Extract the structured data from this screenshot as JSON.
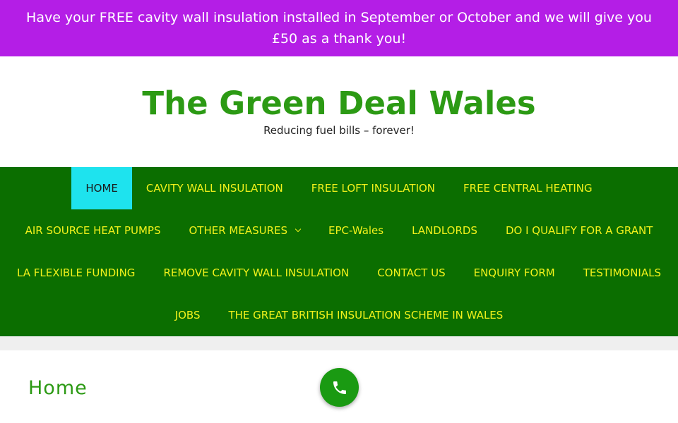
{
  "promo": {
    "text": "Have your FREE cavity wall insulation installed in September or October and we will give you £50 as a thank you!",
    "background": "#b41ee6"
  },
  "site": {
    "title": "The Green Deal Wales",
    "tagline": "Reducing fuel bills – forever!",
    "title_color": "#2c9a14"
  },
  "nav": {
    "background": "#0b6e00",
    "text_color": "#f2f21b",
    "active_background": "#1ee3ee",
    "items": [
      {
        "label": "HOME",
        "active": true
      },
      {
        "label": "CAVITY WALL INSULATION"
      },
      {
        "label": "FREE LOFT INSULATION"
      },
      {
        "label": "FREE CENTRAL HEATING"
      },
      {
        "label": "AIR SOURCE HEAT PUMPS"
      },
      {
        "label": "OTHER MEASURES",
        "has_dropdown": true
      },
      {
        "label": "EPC-Wales"
      },
      {
        "label": "LANDLORDS"
      },
      {
        "label": "DO I QUALIFY FOR A GRANT"
      },
      {
        "label": "LA FLEXIBLE FUNDING"
      },
      {
        "label": "REMOVE CAVITY WALL INSULATION"
      },
      {
        "label": "CONTACT US"
      },
      {
        "label": "ENQUIRY FORM"
      },
      {
        "label": "TESTIMONIALS"
      },
      {
        "label": "JOBS"
      },
      {
        "label": "THE GREAT BRITISH INSULATION SCHEME IN WALES"
      }
    ]
  },
  "page": {
    "title": "Home"
  },
  "call_button": {
    "icon": "phone-icon",
    "color": "#1a9a12"
  }
}
